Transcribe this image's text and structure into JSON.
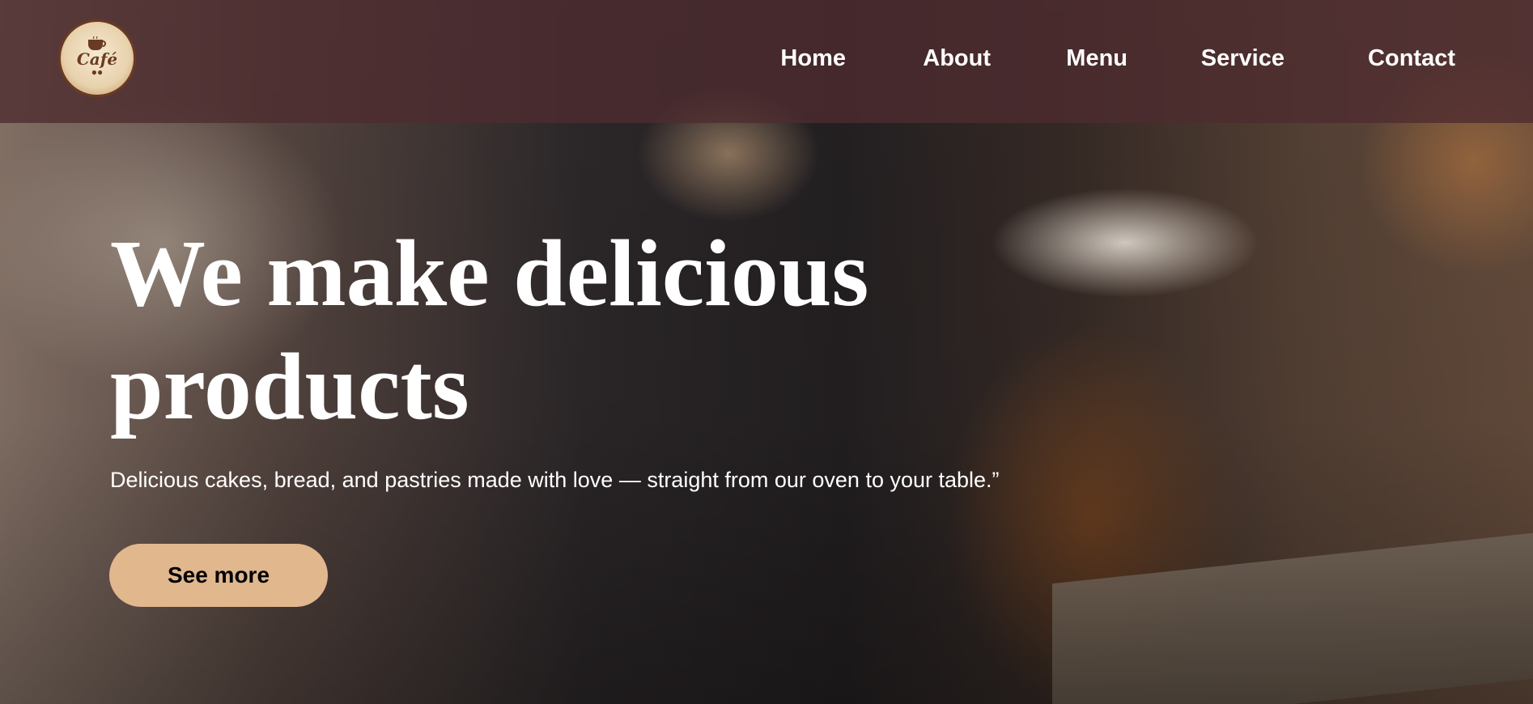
{
  "brand": {
    "logo_text": "Café",
    "logo_icon": "coffee-cup-icon"
  },
  "nav": {
    "items": [
      {
        "label": "Home"
      },
      {
        "label": "About"
      },
      {
        "label": "Menu"
      },
      {
        "label": "Service"
      },
      {
        "label": "Contact"
      }
    ]
  },
  "hero": {
    "headline": "We make delicious products",
    "subtext": "Delicious cakes, bread, and pastries made with love — straight from our oven to your table.”",
    "cta_label": "See more"
  },
  "colors": {
    "navbar": "#4e2b30",
    "cta_background": "#e1b78e",
    "text": "#ffffff"
  }
}
